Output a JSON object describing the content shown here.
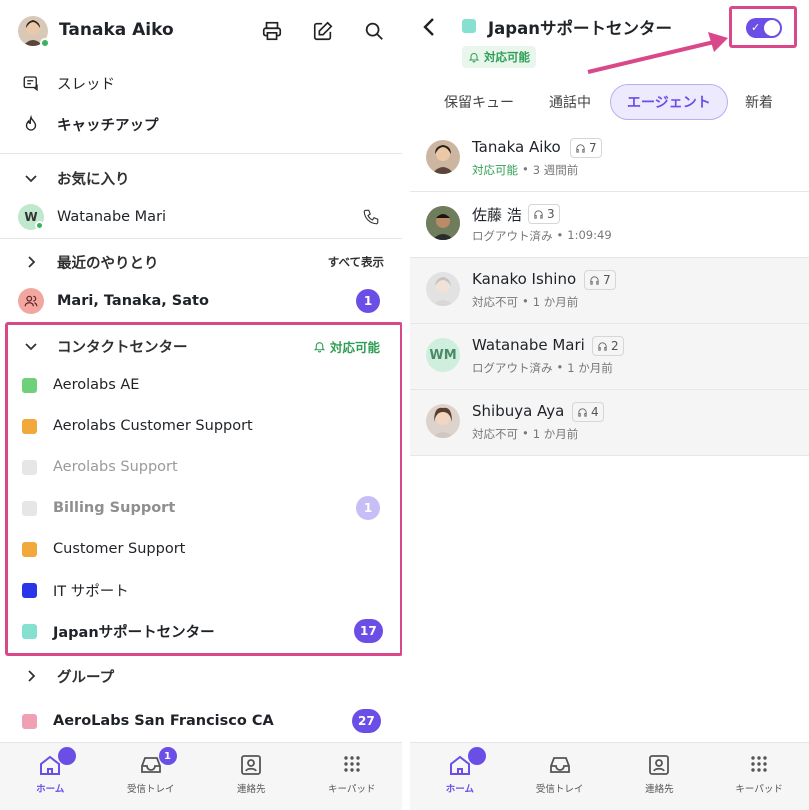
{
  "left": {
    "user_name": "Tanaka Aiko",
    "nav": [
      {
        "label": "スレッド",
        "icon": "threads-icon"
      },
      {
        "label": "キャッチアップ",
        "icon": "flame-icon"
      }
    ],
    "favorites": {
      "title": "お気に入り",
      "items": [
        {
          "label": "Watanabe Mari",
          "initial": "W"
        }
      ]
    },
    "recent": {
      "title": "最近のやりとり",
      "show_all": "すべて表示",
      "items": [
        {
          "label": "Mari, Tanaka, Sato",
          "badge": "1"
        }
      ]
    },
    "contact_center": {
      "title": "コンタクトセンター",
      "status": "対応可能",
      "items": [
        {
          "label": "Aerolabs AE",
          "color": "#6fd07a",
          "state": "active",
          "badge": ""
        },
        {
          "label": "Aerolabs Customer Support",
          "color": "#f2a93b",
          "state": "active",
          "badge": ""
        },
        {
          "label": "Aerolabs Support",
          "color": "#e6e6e6",
          "state": "disabled",
          "badge": ""
        },
        {
          "label": "Billing Support",
          "color": "#e6e6e6",
          "state": "disabled-bold",
          "badge": "1"
        },
        {
          "label": "Customer Support",
          "color": "#f2a93b",
          "state": "active",
          "badge": ""
        },
        {
          "label": "IT サポート",
          "color": "#2b35e8",
          "state": "active",
          "badge": ""
        },
        {
          "label": "Japanサポートセンター",
          "color": "#86e0cf",
          "state": "bold",
          "badge": "17"
        }
      ]
    },
    "group": {
      "title": "グループ",
      "items": [
        {
          "label": "AeroLabs San Francisco CA",
          "color": "#f0a0b4",
          "badge": "27"
        }
      ]
    },
    "tabbar": [
      {
        "label": "ホーム",
        "icon": "home-icon",
        "active": true,
        "badge": ""
      },
      {
        "label": "受信トレイ",
        "icon": "inbox-icon",
        "active": false,
        "badge": "1"
      },
      {
        "label": "連絡先",
        "icon": "contacts-icon",
        "active": false,
        "badge": ""
      },
      {
        "label": "キーパッド",
        "icon": "keypad-icon",
        "active": false,
        "badge": ""
      }
    ]
  },
  "right": {
    "title": "Japanサポートセンター",
    "status": "対応可能",
    "tabs": [
      "保留キュー",
      "通話中",
      "エージェント",
      "新着"
    ],
    "agents": [
      {
        "name": "Tanaka Aiko",
        "count": "7",
        "status": "対応可能",
        "time": "3 週間前",
        "available": true
      },
      {
        "name": "佐藤 浩",
        "count": "3",
        "status": "ログアウト済み",
        "time": "1:09:49",
        "available": false
      },
      {
        "name": "Kanako Ishino",
        "count": "7",
        "status": "対応不可",
        "time": "1 か月前",
        "available": false
      },
      {
        "name": "Watanabe Mari",
        "count": "2",
        "status": "ログアウト済み",
        "time": "1 か月前",
        "available": false,
        "initials": "WM"
      },
      {
        "name": "Shibuya Aya",
        "count": "4",
        "status": "対応不可",
        "time": "1 か月前",
        "available": false
      }
    ],
    "tabbar": [
      {
        "label": "ホーム",
        "icon": "home-icon",
        "active": true
      },
      {
        "label": "受信トレイ",
        "icon": "inbox-icon",
        "active": false
      },
      {
        "label": "連絡先",
        "icon": "contacts-icon",
        "active": false
      },
      {
        "label": "キーパッド",
        "icon": "keypad-icon",
        "active": false
      }
    ]
  },
  "colors": {
    "accent": "#6b4ee6",
    "highlight": "#d9498a",
    "green": "#2f9e55"
  }
}
